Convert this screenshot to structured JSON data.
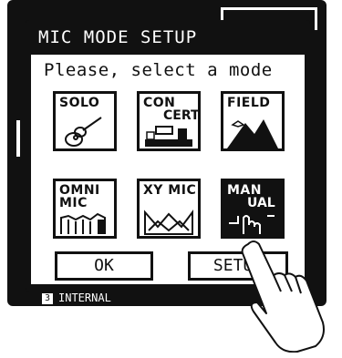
{
  "screen": {
    "title": "MIC MODE SETUP",
    "prompt": "Please, select a mode"
  },
  "modes": [
    {
      "line1": "SOLO",
      "line2": "",
      "icon": "guitar-icon",
      "selected": false
    },
    {
      "line1": "CON",
      "line2": "CERT",
      "icon": "concert-stage-icon",
      "selected": false
    },
    {
      "line1": "FIELD",
      "line2": "",
      "icon": "mountain-icon",
      "selected": false
    },
    {
      "line1": "OMNI",
      "line2": "MIC",
      "icon": "omni-mic-icon",
      "selected": false
    },
    {
      "line1": "XY MIC",
      "line2": "",
      "icon": "xy-mic-icon",
      "selected": false
    },
    {
      "line1": "MAN",
      "line2": "UAL",
      "icon": "manual-hand-icon",
      "selected": true
    }
  ],
  "buttons": {
    "ok": "OK",
    "setup": "SETUP"
  },
  "status": {
    "text": "INTERNAL"
  }
}
